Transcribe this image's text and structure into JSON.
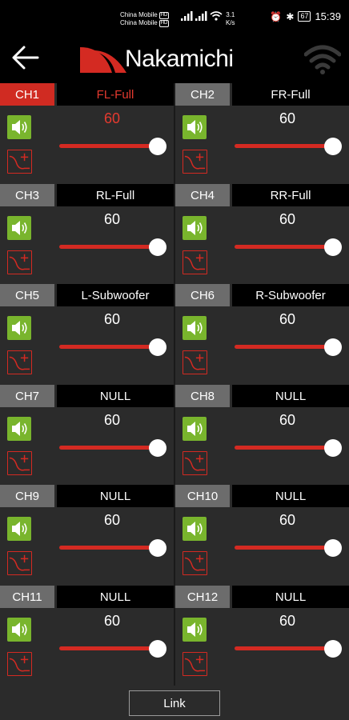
{
  "status_bar": {
    "carrier1": "China Mobile",
    "carrier2": "China Mobile",
    "carrier_badge": "HD",
    "net_speed_value": "3.1",
    "net_speed_unit": "K/s",
    "battery": "67",
    "time": "15:39"
  },
  "app_bar": {
    "logo_text": "Nakamichi",
    "brand_color": "#d42a22"
  },
  "channels": [
    {
      "tag": "CH1",
      "name": "FL-Full",
      "volume": "60",
      "level": 0.92,
      "active": true
    },
    {
      "tag": "CH2",
      "name": "FR-Full",
      "volume": "60",
      "level": 0.92,
      "active": false
    },
    {
      "tag": "CH3",
      "name": "RL-Full",
      "volume": "60",
      "level": 0.92,
      "active": false
    },
    {
      "tag": "CH4",
      "name": "RR-Full",
      "volume": "60",
      "level": 0.92,
      "active": false
    },
    {
      "tag": "CH5",
      "name": "L-Subwoofer",
      "volume": "60",
      "level": 0.92,
      "active": false
    },
    {
      "tag": "CH6",
      "name": "R-Subwoofer",
      "volume": "60",
      "level": 0.92,
      "active": false
    },
    {
      "tag": "CH7",
      "name": "NULL",
      "volume": "60",
      "level": 0.92,
      "active": false
    },
    {
      "tag": "CH8",
      "name": "NULL",
      "volume": "60",
      "level": 0.92,
      "active": false
    },
    {
      "tag": "CH9",
      "name": "NULL",
      "volume": "60",
      "level": 0.92,
      "active": false
    },
    {
      "tag": "CH10",
      "name": "NULL",
      "volume": "60",
      "level": 0.92,
      "active": false
    },
    {
      "tag": "CH11",
      "name": "NULL",
      "volume": "60",
      "level": 0.92,
      "active": false
    },
    {
      "tag": "CH12",
      "name": "NULL",
      "volume": "60",
      "level": 0.92,
      "active": false
    }
  ],
  "icons": {
    "back": "back-arrow-icon",
    "wifi": "wifi-icon",
    "speaker": "speaker-icon",
    "eq": "eq-curve-plus-icon"
  },
  "footer": {
    "link_label": "Link"
  }
}
